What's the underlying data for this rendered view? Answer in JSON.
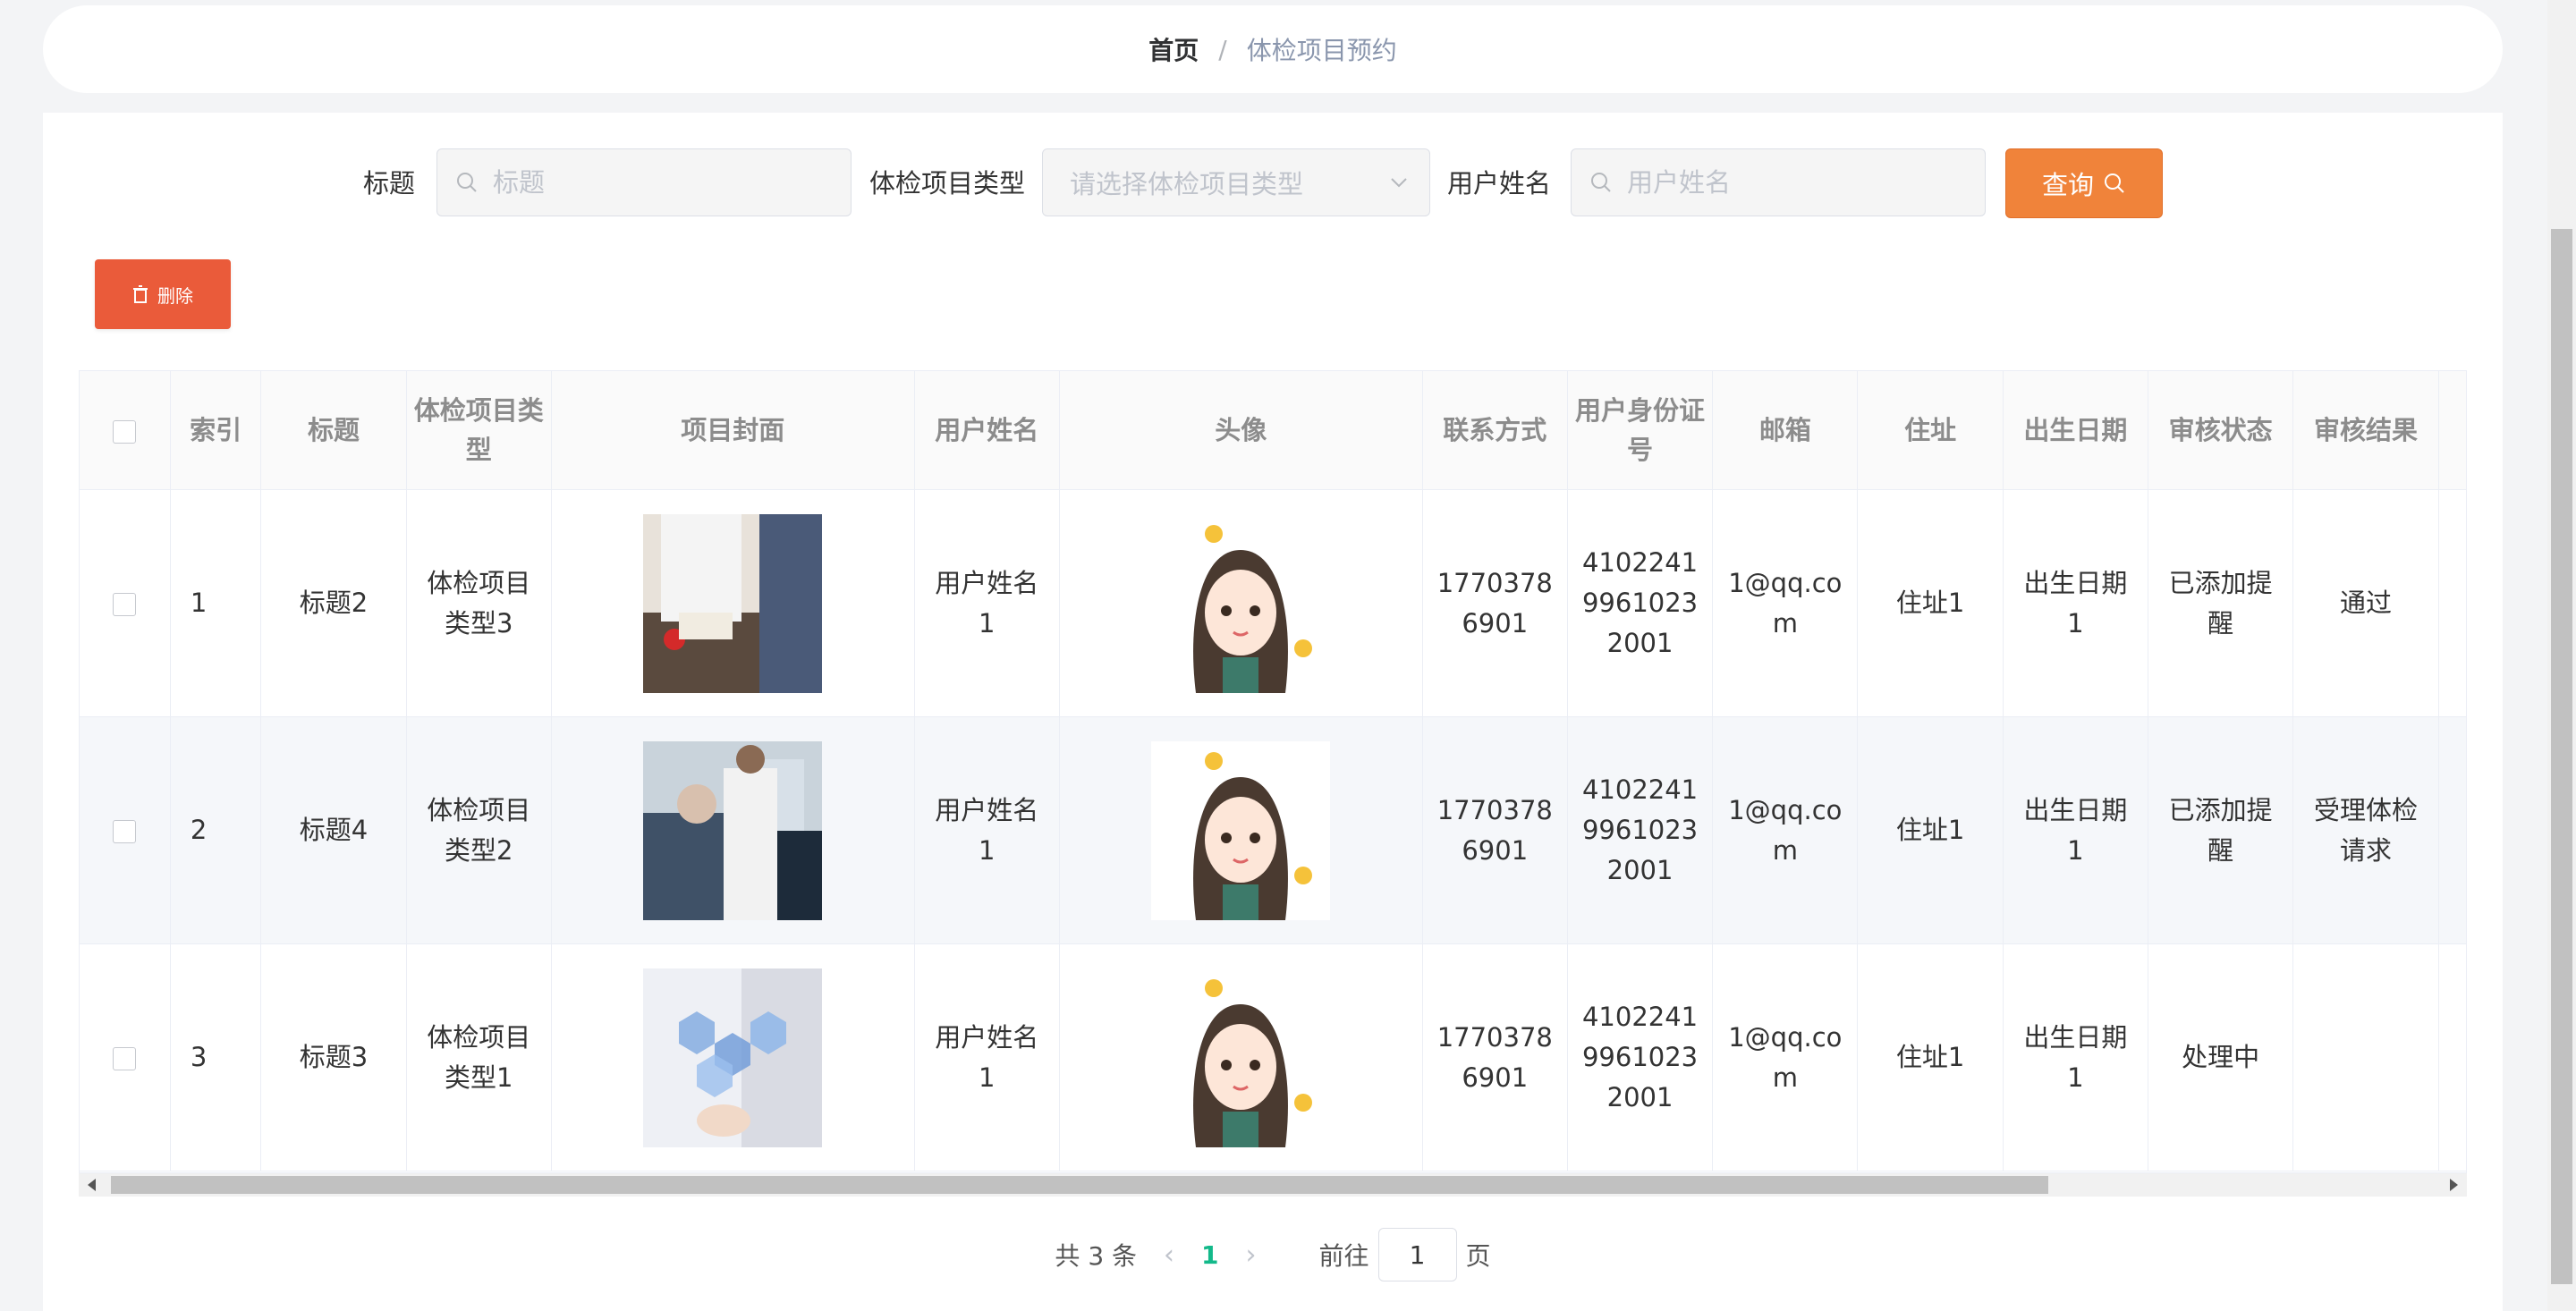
{
  "breadcrumb": {
    "home": "首页",
    "separator": "/",
    "current": "体检项目预约"
  },
  "search": {
    "title_label": "标题",
    "title_placeholder": "标题",
    "type_label": "体检项目类型",
    "type_placeholder": "请选择体检项目类型",
    "username_label": "用户姓名",
    "username_placeholder": "用户姓名",
    "query_label": "查询"
  },
  "toolbar": {
    "delete_label": "删除"
  },
  "table": {
    "headers": [
      "索引",
      "标题",
      "体检项目类型",
      "项目封面",
      "用户姓名",
      "头像",
      "联系方式",
      "用户身份证号",
      "邮箱",
      "住址",
      "出生日期",
      "审核状态",
      "审核结果"
    ],
    "rows": [
      {
        "index": "1",
        "title": "标题2",
        "type": "体检项目类型3",
        "username": "用户姓名1",
        "phone": "17703786901",
        "id_number": "410224199610232001",
        "email": "1@qq.com",
        "address": "住址1",
        "birth": "出生日期1",
        "status": "已添加提醒",
        "result": "通过"
      },
      {
        "index": "2",
        "title": "标题4",
        "type": "体检项目类型2",
        "username": "用户姓名1",
        "phone": "17703786901",
        "id_number": "410224199610232001",
        "email": "1@qq.com",
        "address": "住址1",
        "birth": "出生日期1",
        "status": "已添加提醒",
        "result": "受理体检请求"
      },
      {
        "index": "3",
        "title": "标题3",
        "type": "体检项目类型1",
        "username": "用户姓名1",
        "phone": "17703786901",
        "id_number": "410224199610232001",
        "email": "1@qq.com",
        "address": "住址1",
        "birth": "出生日期1",
        "status": "处理中",
        "result": ""
      }
    ]
  },
  "pagination": {
    "total_text": "共 3 条",
    "current_page": "1",
    "goto_label": "前往",
    "goto_value": "1",
    "page_suffix": "页"
  },
  "colors": {
    "query_button": "#f0833a",
    "delete_button": "#ea5b3a",
    "active_page": "#13b98a"
  }
}
